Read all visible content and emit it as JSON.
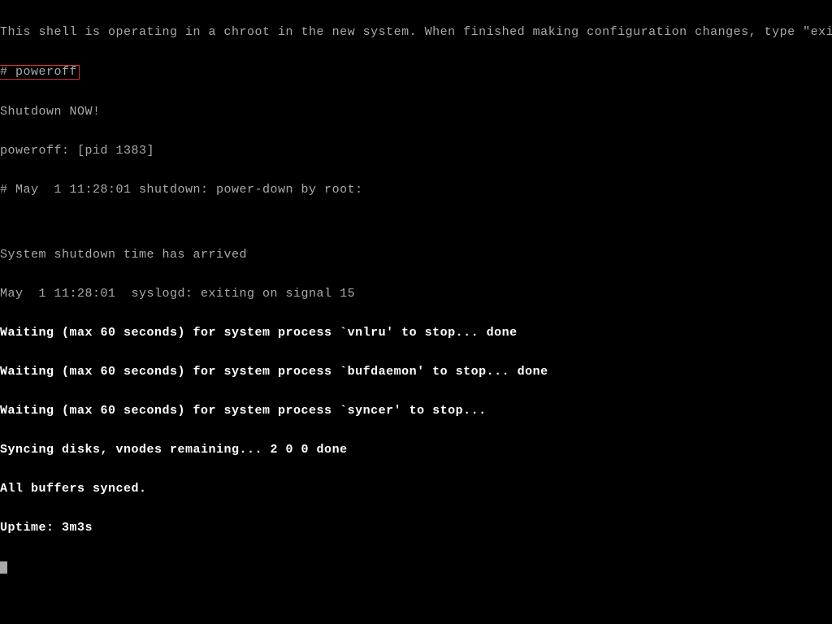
{
  "terminal": {
    "lines": [
      {
        "class": "dim",
        "text": "This shell is operating in a chroot in the new system. When finished making configuration changes, type \"exit\"."
      },
      {
        "class": "dim highlight",
        "text": "# poweroff"
      },
      {
        "class": "dim",
        "text": "Shutdown NOW!"
      },
      {
        "class": "dim",
        "text": "poweroff: [pid 1383]"
      },
      {
        "class": "dim",
        "text": "# May  1 11:28:01 shutdown: power-down by root:"
      },
      {
        "class": "dim",
        "text": ""
      },
      {
        "class": "dim",
        "text": "System shutdown time has arrived"
      },
      {
        "class": "dim",
        "text": "May  1 11:28:01  syslogd: exiting on signal 15"
      },
      {
        "class": "bright",
        "text": "Waiting (max 60 seconds) for system process `vnlru' to stop... done"
      },
      {
        "class": "bright",
        "text": "Waiting (max 60 seconds) for system process `bufdaemon' to stop... done"
      },
      {
        "class": "bright",
        "text": "Waiting (max 60 seconds) for system process `syncer' to stop..."
      },
      {
        "class": "bright",
        "text": "Syncing disks, vnodes remaining... 2 0 0 done"
      },
      {
        "class": "bright",
        "text": "All buffers synced."
      },
      {
        "class": "bright",
        "text": "Uptime: 3m3s"
      }
    ],
    "highlight_prefix": "# ",
    "highlight_command": "poweroff"
  }
}
